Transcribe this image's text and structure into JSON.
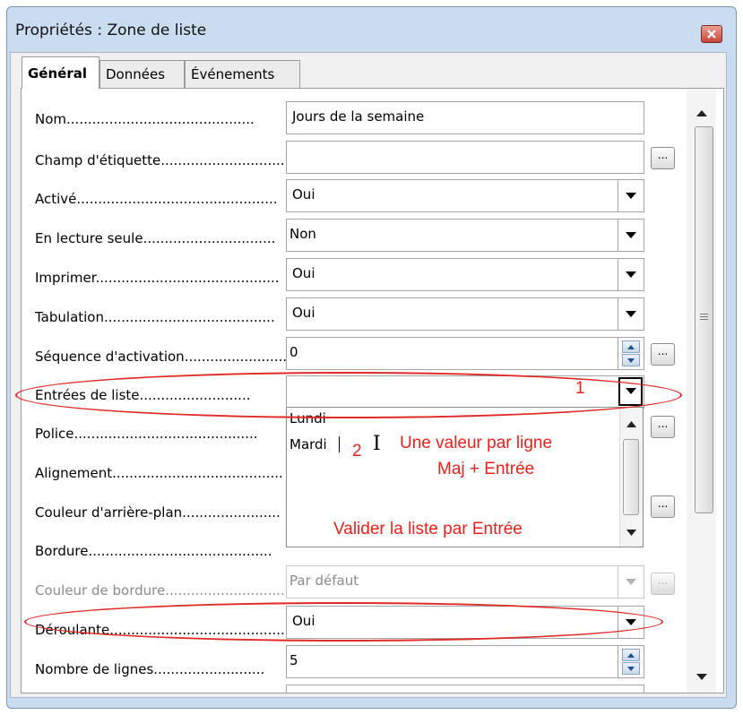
{
  "dialog": {
    "title": "Propriétés : Zone de liste",
    "tabs": [
      {
        "label": "Général",
        "active": true
      },
      {
        "label": "Données",
        "active": false
      },
      {
        "label": "Événements",
        "active": false
      }
    ]
  },
  "properties": {
    "nom": {
      "label": "Nom............................................",
      "value": "Jours de la semaine"
    },
    "champ_etiquette": {
      "label": "Champ d'étiquette...............................",
      "value": "",
      "button": "..."
    },
    "active": {
      "label": "Activé...............................................",
      "value": "Oui"
    },
    "lecture_seule": {
      "label": "En lecture seule...............................",
      "value": "Non"
    },
    "imprimer": {
      "label": "Imprimer...........................................",
      "value": "Oui"
    },
    "tabulation": {
      "label": "Tabulation........................................",
      "value": "Oui"
    },
    "sequence": {
      "label": "Séquence d'activation...........................",
      "value": "0",
      "button": "..."
    },
    "entrees": {
      "label": "Entrées de liste..........................",
      "value": ""
    },
    "police": {
      "label": "Police...........................................",
      "button": "..."
    },
    "alignement": {
      "label": "Alignement........................................"
    },
    "couleur_fond": {
      "label": "Couleur d'arrière-plan.......................",
      "button": "..."
    },
    "bordure": {
      "label": "Bordure..........................................."
    },
    "couleur_bordure": {
      "label": "Couleur de bordure............................",
      "value": "Par défaut",
      "button": "..."
    },
    "deroulante": {
      "label": "Déroulante...........................................",
      "value": "Oui"
    },
    "nb_lignes": {
      "label": "Nombre de lignes..........................",
      "value": "5"
    }
  },
  "list_entries_popup": {
    "lines": [
      "Lundi",
      "Mardi"
    ]
  },
  "annotations": {
    "marker_1": "1",
    "marker_2": "2",
    "note_line_1": "Une valeur par ligne",
    "note_line_2": "Maj + Entrée",
    "note_validate": "Valider la liste par Entrée"
  },
  "colors": {
    "annotation_red": "#e8201c",
    "window_frame": "#c9dcf0"
  }
}
